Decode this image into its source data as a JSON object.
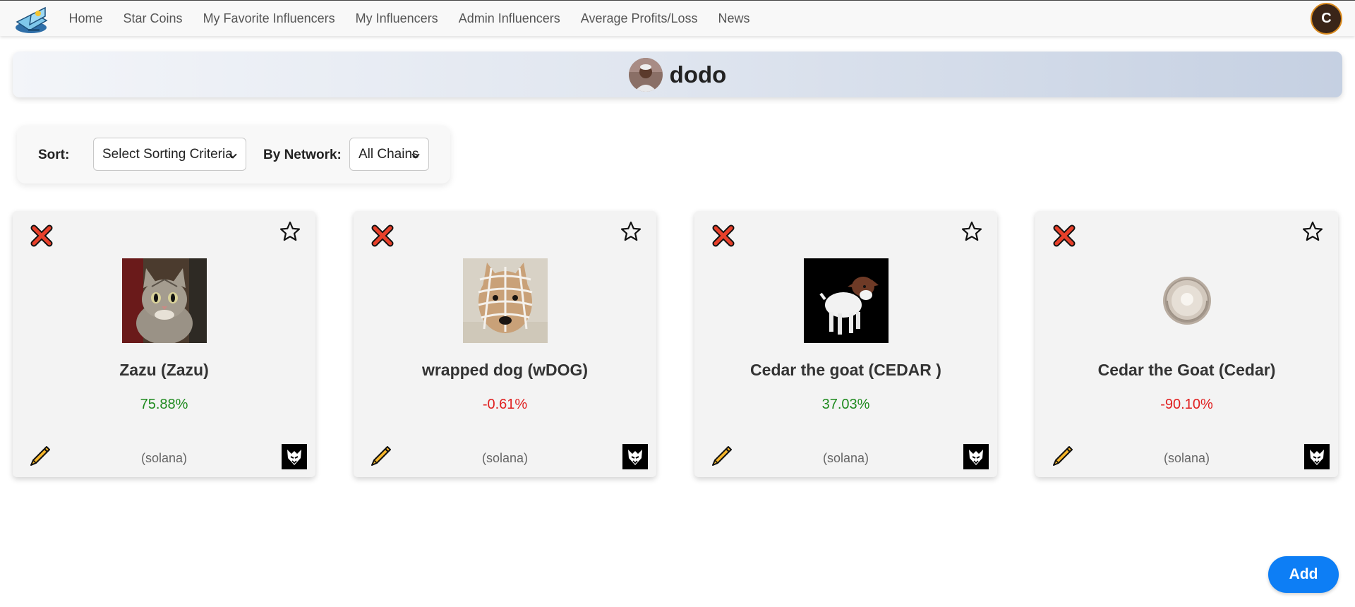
{
  "nav": {
    "links": [
      "Home",
      "Star Coins",
      "My Favorite Influencers",
      "My Influencers",
      "Admin Influencers",
      "Average Profits/Loss",
      "News"
    ],
    "user_initial": "C"
  },
  "profile": {
    "name": "dodo"
  },
  "filters": {
    "sort_label": "Sort:",
    "sort_value": "Select Sorting Criteria",
    "network_label": "By Network:",
    "network_value": "All Chains"
  },
  "cards": [
    {
      "name": "Zazu (Zazu)",
      "change": "75.88%",
      "network": "(solana)",
      "image": "cat"
    },
    {
      "name": "wrapped dog (wDOG)",
      "change": "-0.61%",
      "network": "(solana)",
      "image": "dog"
    },
    {
      "name": "Cedar the goat (CEDAR )",
      "change": "37.03%",
      "network": "(solana)",
      "image": "goat"
    },
    {
      "name": "Cedar the Goat (Cedar)",
      "change": "-90.10%",
      "network": "(solana)",
      "image": "coin"
    }
  ],
  "colors": {
    "positive": "#1e8a1e",
    "negative": "#e02020",
    "accent": "#0d7ef5"
  },
  "add_label": "Add"
}
